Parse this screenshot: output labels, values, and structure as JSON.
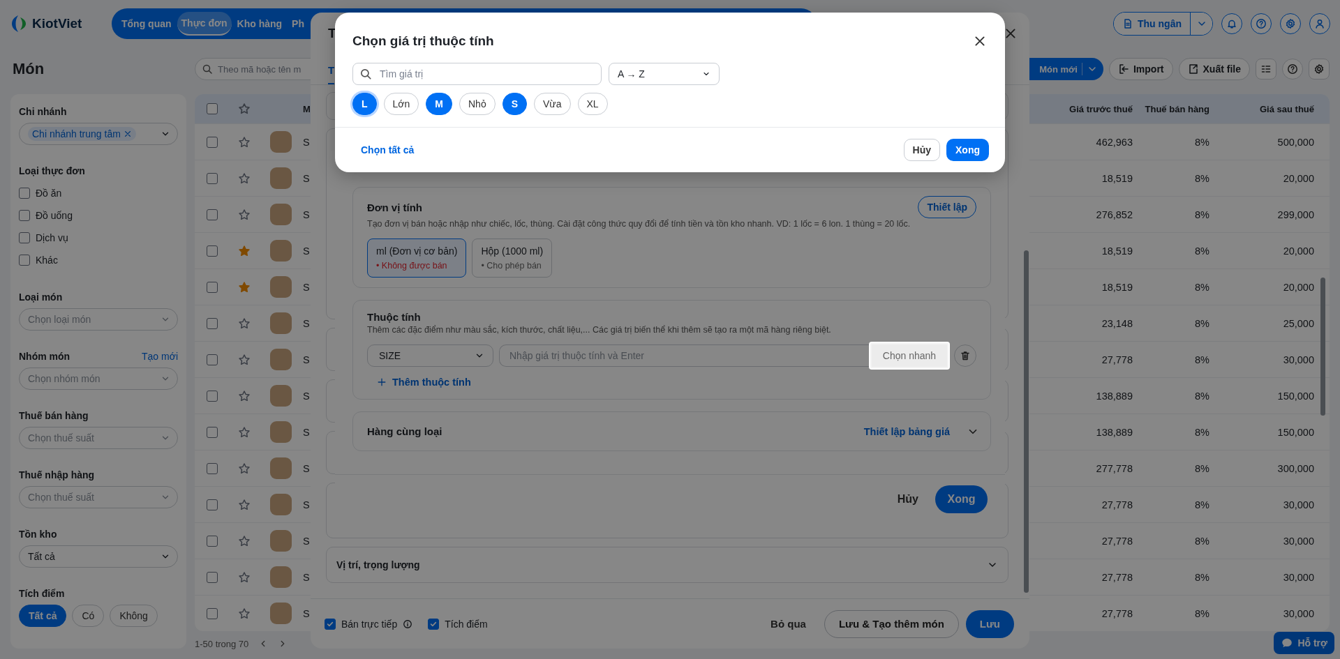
{
  "topbar": {
    "logo": "KiotViet",
    "nav": [
      {
        "label": "Tổng quan",
        "selected": false
      },
      {
        "label": "Thực đơn",
        "selected": true
      },
      {
        "label": "Kho hàng",
        "selected": false
      },
      {
        "label": "Ph",
        "selected": false
      }
    ],
    "cashier": "Thu ngân"
  },
  "page": {
    "title": "Món",
    "search": {
      "placeholder": "Theo mã hoặc tên m"
    },
    "new_button": "Món mới",
    "import_button": "Import",
    "export_button": "Xuất file"
  },
  "filters": {
    "branch": {
      "label": "Chi nhánh",
      "tags": [
        "Chi nhánh trung tâm"
      ]
    },
    "menu_type": {
      "label": "Loại thực đơn",
      "options": [
        {
          "label": "Đồ ăn",
          "checked": false
        },
        {
          "label": "Đồ uống",
          "checked": false
        },
        {
          "label": "Dịch vụ",
          "checked": false
        },
        {
          "label": "Khác",
          "checked": false
        }
      ]
    },
    "selects": [
      {
        "label": "Loại món",
        "placeholder": "Chọn loại món"
      },
      {
        "label": "Nhóm món",
        "link": "Tạo mới",
        "placeholder": "Chọn nhóm món"
      },
      {
        "label": "Thuế bán hàng",
        "placeholder": "Chọn thuế suất"
      },
      {
        "label": "Thuế nhập hàng",
        "placeholder": "Chọn thuế suất"
      },
      {
        "label": "Tồn kho",
        "value": "Tất cả"
      }
    ],
    "points": {
      "label": "Tích điểm",
      "options": [
        {
          "label": "Tất cả",
          "selected": true
        },
        {
          "label": "Có",
          "selected": false
        },
        {
          "label": "Không",
          "selected": false
        }
      ]
    }
  },
  "table": {
    "header_checked": false,
    "columns": [
      "M",
      "Giá trước thuế",
      "Thuế bán hàng",
      "Giá sau thuế"
    ],
    "rows": [
      {
        "checked": false,
        "starred": false,
        "code": "S",
        "price_before_tax": "462,963",
        "sales_tax": "8%",
        "price_after_tax": "500,000"
      },
      {
        "checked": false,
        "starred": false,
        "code": "S",
        "price_before_tax": "18,519",
        "sales_tax": "8%",
        "price_after_tax": "20,000"
      },
      {
        "checked": false,
        "starred": false,
        "code": "S",
        "price_before_tax": "276,852",
        "sales_tax": "8%",
        "price_after_tax": "299,000"
      },
      {
        "checked": false,
        "starred": true,
        "code": "S",
        "price_before_tax": "18,519",
        "sales_tax": "8%",
        "price_after_tax": "20,000"
      },
      {
        "checked": false,
        "starred": true,
        "code": "S",
        "price_before_tax": "18,519",
        "sales_tax": "8%",
        "price_after_tax": "20,000"
      },
      {
        "checked": false,
        "starred": false,
        "code": "S",
        "price_before_tax": "23,148",
        "sales_tax": "8%",
        "price_after_tax": "25,000"
      },
      {
        "checked": false,
        "starred": false,
        "code": "S",
        "price_before_tax": "27,778",
        "sales_tax": "8%",
        "price_after_tax": "30,000"
      },
      {
        "checked": false,
        "starred": false,
        "code": "S",
        "price_before_tax": "138,889",
        "sales_tax": "8%",
        "price_after_tax": "150,000"
      },
      {
        "checked": false,
        "starred": false,
        "code": "S",
        "price_before_tax": "138,889",
        "sales_tax": "8%",
        "price_after_tax": "150,000"
      },
      {
        "checked": false,
        "starred": false,
        "code": "S",
        "price_before_tax": "277,778",
        "sales_tax": "8%",
        "price_after_tax": "300,000"
      },
      {
        "checked": false,
        "starred": false,
        "code": "S",
        "price_before_tax": "27,778",
        "sales_tax": "8%",
        "price_after_tax": "30,000"
      },
      {
        "checked": false,
        "starred": false,
        "code": "S",
        "price_before_tax": "27,778",
        "sales_tax": "8%",
        "price_after_tax": "30,000"
      },
      {
        "checked": false,
        "starred": false,
        "code": "S",
        "price_before_tax": "27,778",
        "sales_tax": "8%",
        "price_after_tax": "30,000"
      },
      {
        "checked": false,
        "starred": false,
        "code": "S",
        "price_before_tax": "27,778",
        "sales_tax": "8%",
        "price_after_tax": "30,000"
      }
    ],
    "pagination": "1-50 trong 70"
  },
  "product_modal": {
    "title": "T",
    "tabs": [
      {
        "label": "T",
        "selected": true
      }
    ],
    "section_title": "Vị trí, trọng lượng",
    "direct_sale": {
      "label": "Bán trực tiếp",
      "checked": true
    },
    "points": {
      "label": "Tích điểm",
      "checked": true
    },
    "skip_button": "Bỏ qua",
    "save_new_button": "Lưu & Tạo thêm món",
    "save_button": "Lưu"
  },
  "attribute_dialog": {
    "unit_card": {
      "title": "Đơn vị tính",
      "description": "Tạo đơn vị bán hoặc nhập như chiếc, lốc, thùng. Cài đặt công thức quy đổi để tính tiền và tồn kho nhanh. VD: 1 lốc = 6 lon. 1 thùng = 20 lốc.",
      "setup_button": "Thiết lập"
    },
    "units": [
      {
        "name": "ml (Đơn vị cơ bản)",
        "status": "• Không được bán",
        "sellable": false,
        "selected": true
      },
      {
        "name": "Hộp (1000 ml)",
        "status": "• Cho phép bán",
        "sellable": true,
        "selected": false
      }
    ],
    "attribute_card": {
      "title": "Thuộc tính",
      "description": "Thêm các đặc điểm như màu sắc, kích thước, chất liệu,... Các giá trị biến thể khi thêm sẽ tạo ra một mã hàng riêng biệt.",
      "attribute": "SIZE",
      "value_placeholder": "Nhập giá trị thuộc tính và Enter",
      "quick_pick_button": "Chọn nhanh",
      "add_link": "Thêm thuộc tính"
    },
    "variant_card": {
      "title": "Hàng cùng loại",
      "link": "Thiết lập bảng giá"
    },
    "cancel_button": "Hủy",
    "done_button": "Xong"
  },
  "value_picker": {
    "title": "Chọn giá trị thuộc tính",
    "search": {
      "placeholder": "Tìm giá trị"
    },
    "sort": "A → Z",
    "chips": [
      {
        "label": "L",
        "selected": true,
        "focused": true
      },
      {
        "label": "Lớn",
        "selected": false,
        "focused": false
      },
      {
        "label": "M",
        "selected": true,
        "focused": false
      },
      {
        "label": "Nhỏ",
        "selected": false,
        "focused": false
      },
      {
        "label": "S",
        "selected": true,
        "focused": false
      },
      {
        "label": "Vừa",
        "selected": false,
        "focused": false
      },
      {
        "label": "XL",
        "selected": false,
        "focused": false
      }
    ],
    "select_all": "Chọn tất cả",
    "cancel_button": "Hủy",
    "done_button": "Xong"
  },
  "support_button": "Hỗ trợ"
}
